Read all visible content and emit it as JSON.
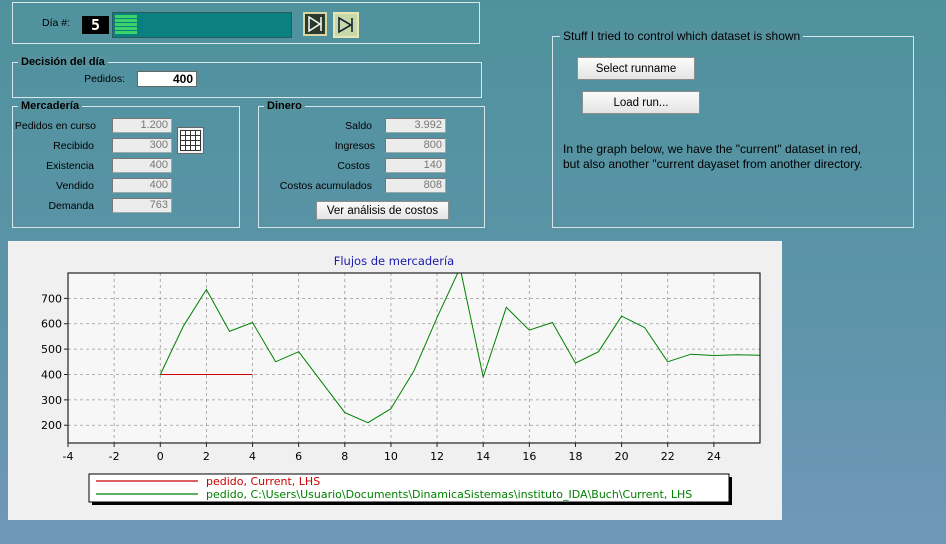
{
  "top": {
    "dia_label": "Día #:",
    "dia_value": "5"
  },
  "decision": {
    "title": "Decisión del día",
    "pedidos_label": "Pedidos:",
    "pedidos_value": "400"
  },
  "mercaderia": {
    "title": "Mercadería",
    "rows": [
      {
        "label": "Pedidos en curso",
        "value": "1.200"
      },
      {
        "label": "Recibido",
        "value": "300"
      },
      {
        "label": "Existencia",
        "value": "400"
      },
      {
        "label": "Vendido",
        "value": "400"
      },
      {
        "label": "Demanda",
        "value": "763"
      }
    ]
  },
  "dinero": {
    "title": "Dinero",
    "rows": [
      {
        "label": "Saldo",
        "value": "3.992"
      },
      {
        "label": "Ingresos",
        "value": "800"
      },
      {
        "label": "Costos",
        "value": "140"
      },
      {
        "label": "Costos acumulados",
        "value": "808"
      }
    ],
    "button": "Ver análisis de costos"
  },
  "dataset": {
    "title": "Stuff I tried to control which dataset is shown",
    "select_button": "Select runname",
    "load_button": "Load run...",
    "note_line1": "In the graph below, we have the \"current\" dataset in red,",
    "note_line2": "but also another \"current dayaset from another directory."
  },
  "colors": {
    "accent": "#008080",
    "red_series": "#cc0000",
    "green_series": "#008000"
  },
  "chart_data": {
    "type": "line",
    "title": "Flujos de mercadería",
    "xlim": [
      -4,
      26
    ],
    "ylim": [
      130,
      800
    ],
    "xticks": [
      -4,
      -2,
      0,
      2,
      4,
      6,
      8,
      10,
      12,
      14,
      16,
      18,
      20,
      22,
      24
    ],
    "yticks": [
      200,
      300,
      400,
      500,
      600,
      700
    ],
    "grid": true,
    "legend_position": "bottom",
    "series": [
      {
        "name": "pedido, Current, LHS",
        "color": "#cc0000",
        "x": [
          0,
          1,
          2,
          3,
          4
        ],
        "y": [
          400,
          400,
          400,
          400,
          400
        ]
      },
      {
        "name": "pedido, C:\\Users\\Usuario\\Documents\\DinamicaSistemas\\instituto_IDA\\Buch\\Current, LHS",
        "color": "#008000",
        "x": [
          0,
          1,
          2,
          3,
          4,
          5,
          6,
          7,
          8,
          9,
          10,
          11,
          12,
          13,
          14,
          15,
          16,
          17,
          18,
          19,
          20,
          21,
          22,
          23,
          24,
          25,
          26
        ],
        "y": [
          400,
          590,
          735,
          570,
          605,
          450,
          490,
          370,
          250,
          210,
          265,
          415,
          625,
          820,
          390,
          665,
          575,
          605,
          445,
          490,
          630,
          585,
          450,
          480,
          475,
          478,
          476
        ]
      }
    ]
  }
}
